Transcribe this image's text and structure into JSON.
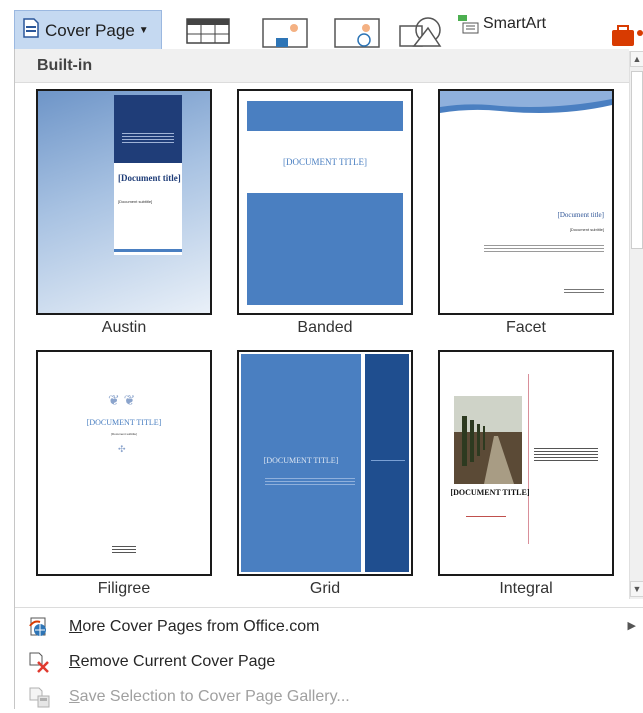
{
  "ribbon": {
    "cover_page_label": "Cover Page",
    "smartart_label": "SmartArt"
  },
  "gallery": {
    "section_title": "Built-in",
    "templates": [
      {
        "name": "Austin"
      },
      {
        "name": "Banded"
      },
      {
        "name": "Facet"
      },
      {
        "name": "Filigree"
      },
      {
        "name": "Grid"
      },
      {
        "name": "Integral"
      }
    ],
    "previews": {
      "austin_title": "[Document title]",
      "austin_subtitle": "[Document subtitle]",
      "banded_title": "[DOCUMENT TITLE]",
      "facet_title": "[Document title]",
      "facet_subtitle": "[Document subtitle]",
      "filigree_title": "[DOCUMENT TITLE]",
      "filigree_subtitle": "[Document subtitle]",
      "grid_title": "[DOCUMENT TITLE]",
      "integral_title": "[DOCUMENT TITLE]"
    }
  },
  "menu": {
    "more_label_first": "M",
    "more_label_rest": "ore Cover Pages from Office.com",
    "remove_label_first": "R",
    "remove_label_rest": "emove Current Cover Page",
    "save_label_first": "S",
    "save_label_rest": "ave Selection to Cover Page Gallery..."
  },
  "colors": {
    "accent_blue": "#4a7fc1",
    "navy": "#1f3d78",
    "button_highlight": "#c5d9f1"
  }
}
